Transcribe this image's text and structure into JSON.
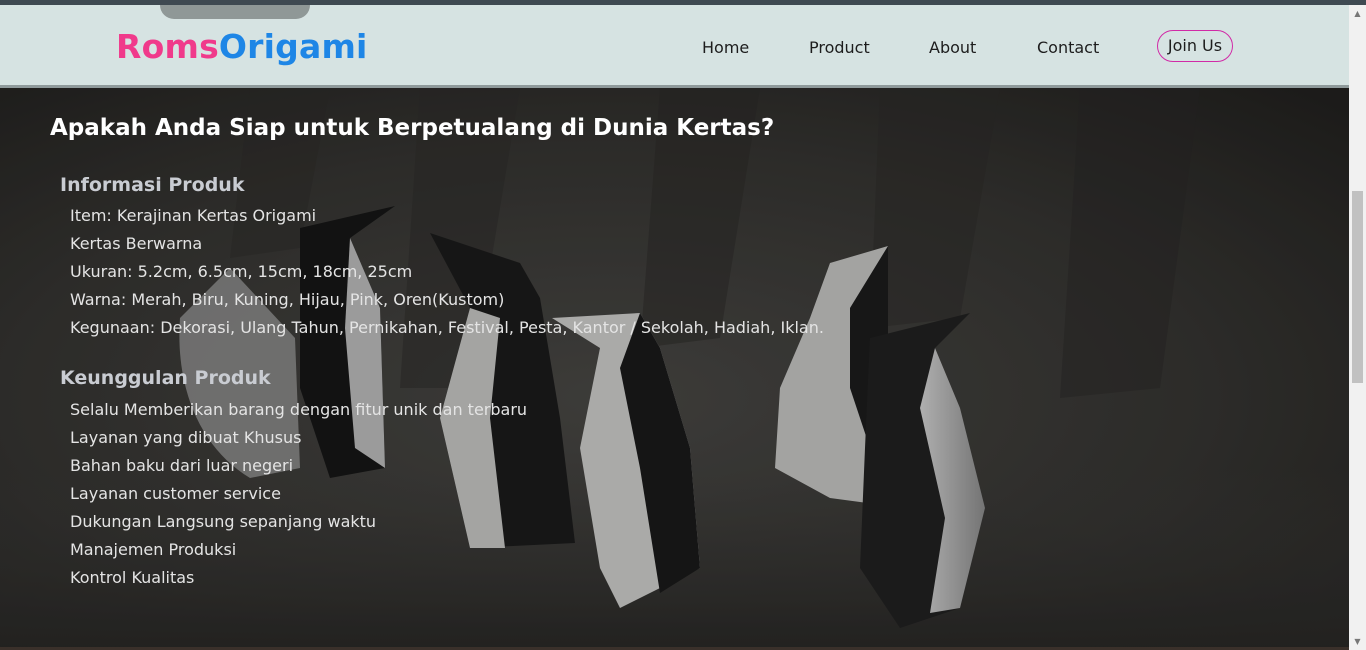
{
  "brand": {
    "part1": "Roms",
    "part2": "Origami",
    "color1": "#f03a8b",
    "color2": "#1e86e6"
  },
  "nav": {
    "home": "Home",
    "product": "Product",
    "about": "About",
    "contact": "Contact",
    "join": "Join Us",
    "join_border_color": "#d12aa7"
  },
  "hero": {
    "headline": "Apakah Anda Siap untuk Berpetualang di Dunia Kertas?",
    "info_title": "Informasi Produk",
    "info_items": [
      "Item: Kerajinan Kertas Origami",
      "Kertas Berwarna",
      "Ukuran: 5.2cm, 6.5cm, 15cm, 18cm, 25cm",
      "Warna: Merah, Biru, Kuning, Hijau, Pink, Oren(Kustom)",
      "Kegunaan: Dekorasi, Ulang Tahun, Pernikahan, Festival, Pesta, Kantor / Sekolah, Hadiah, Iklan."
    ],
    "advantages_title": "Keunggulan Produk",
    "advantages_items": [
      "Selalu Memberikan barang dengan fitur unik dan terbaru",
      "Layanan yang dibuat Khusus",
      "Bahan baku dari luar negeri",
      "Layanan customer service",
      "Dukungan Langsung sepanjang waktu",
      "Manajemen Produksi",
      "Kontrol Kualitas"
    ],
    "background_image": "origami-penguins-photo"
  }
}
